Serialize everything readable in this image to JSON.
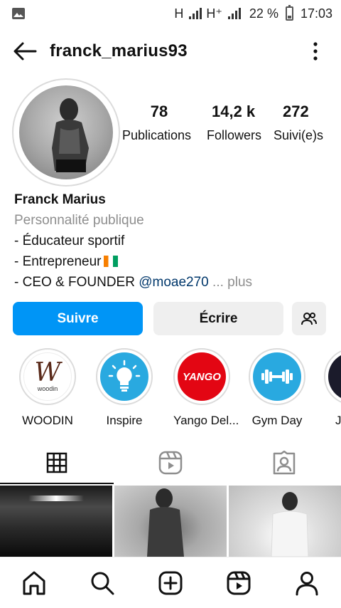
{
  "status_bar": {
    "network_1": "H",
    "network_2": "H⁺",
    "battery": "22 %",
    "time": "17:03"
  },
  "header": {
    "username": "franck_marius93"
  },
  "stats": [
    {
      "value": "78",
      "label": "Publications"
    },
    {
      "value": "14,2 k",
      "label": "Followers"
    },
    {
      "value": "272",
      "label": "Suivi(e)s"
    }
  ],
  "bio": {
    "name": "Franck Marius",
    "category": "Personnalité publique",
    "line1": "- Éducateur sportif",
    "line2": "- Entrepreneur",
    "line3_prefix": "- CEO & FOUNDER ",
    "mention": "@moae270",
    "more": " ... plus"
  },
  "actions": {
    "follow": "Suivre",
    "message": "Écrire"
  },
  "highlights": [
    {
      "label": "WOODIN",
      "icon": "woodin-logo-icon"
    },
    {
      "label": "Inspire",
      "icon": "lightbulb-icon"
    },
    {
      "label": "Yango Del...",
      "icon": "yango-logo-icon"
    },
    {
      "label": "Gym Day",
      "icon": "dumbbell-icon"
    },
    {
      "label": "J",
      "icon": "partial-highlight-icon"
    }
  ],
  "logos": {
    "woodin_mark": "W",
    "woodin_word": "woodin",
    "yango": "YANGO"
  },
  "colors": {
    "accent": "#0095f6",
    "inspire_bg": "#29a9e0",
    "yango_red": "#e30613",
    "gym_bg": "#29a9e0"
  },
  "tabs": [
    "grid-icon",
    "reels-icon",
    "tagged-icon"
  ],
  "bottom_nav": [
    "home-icon",
    "search-icon",
    "create-icon",
    "reels-icon",
    "profile-icon"
  ]
}
